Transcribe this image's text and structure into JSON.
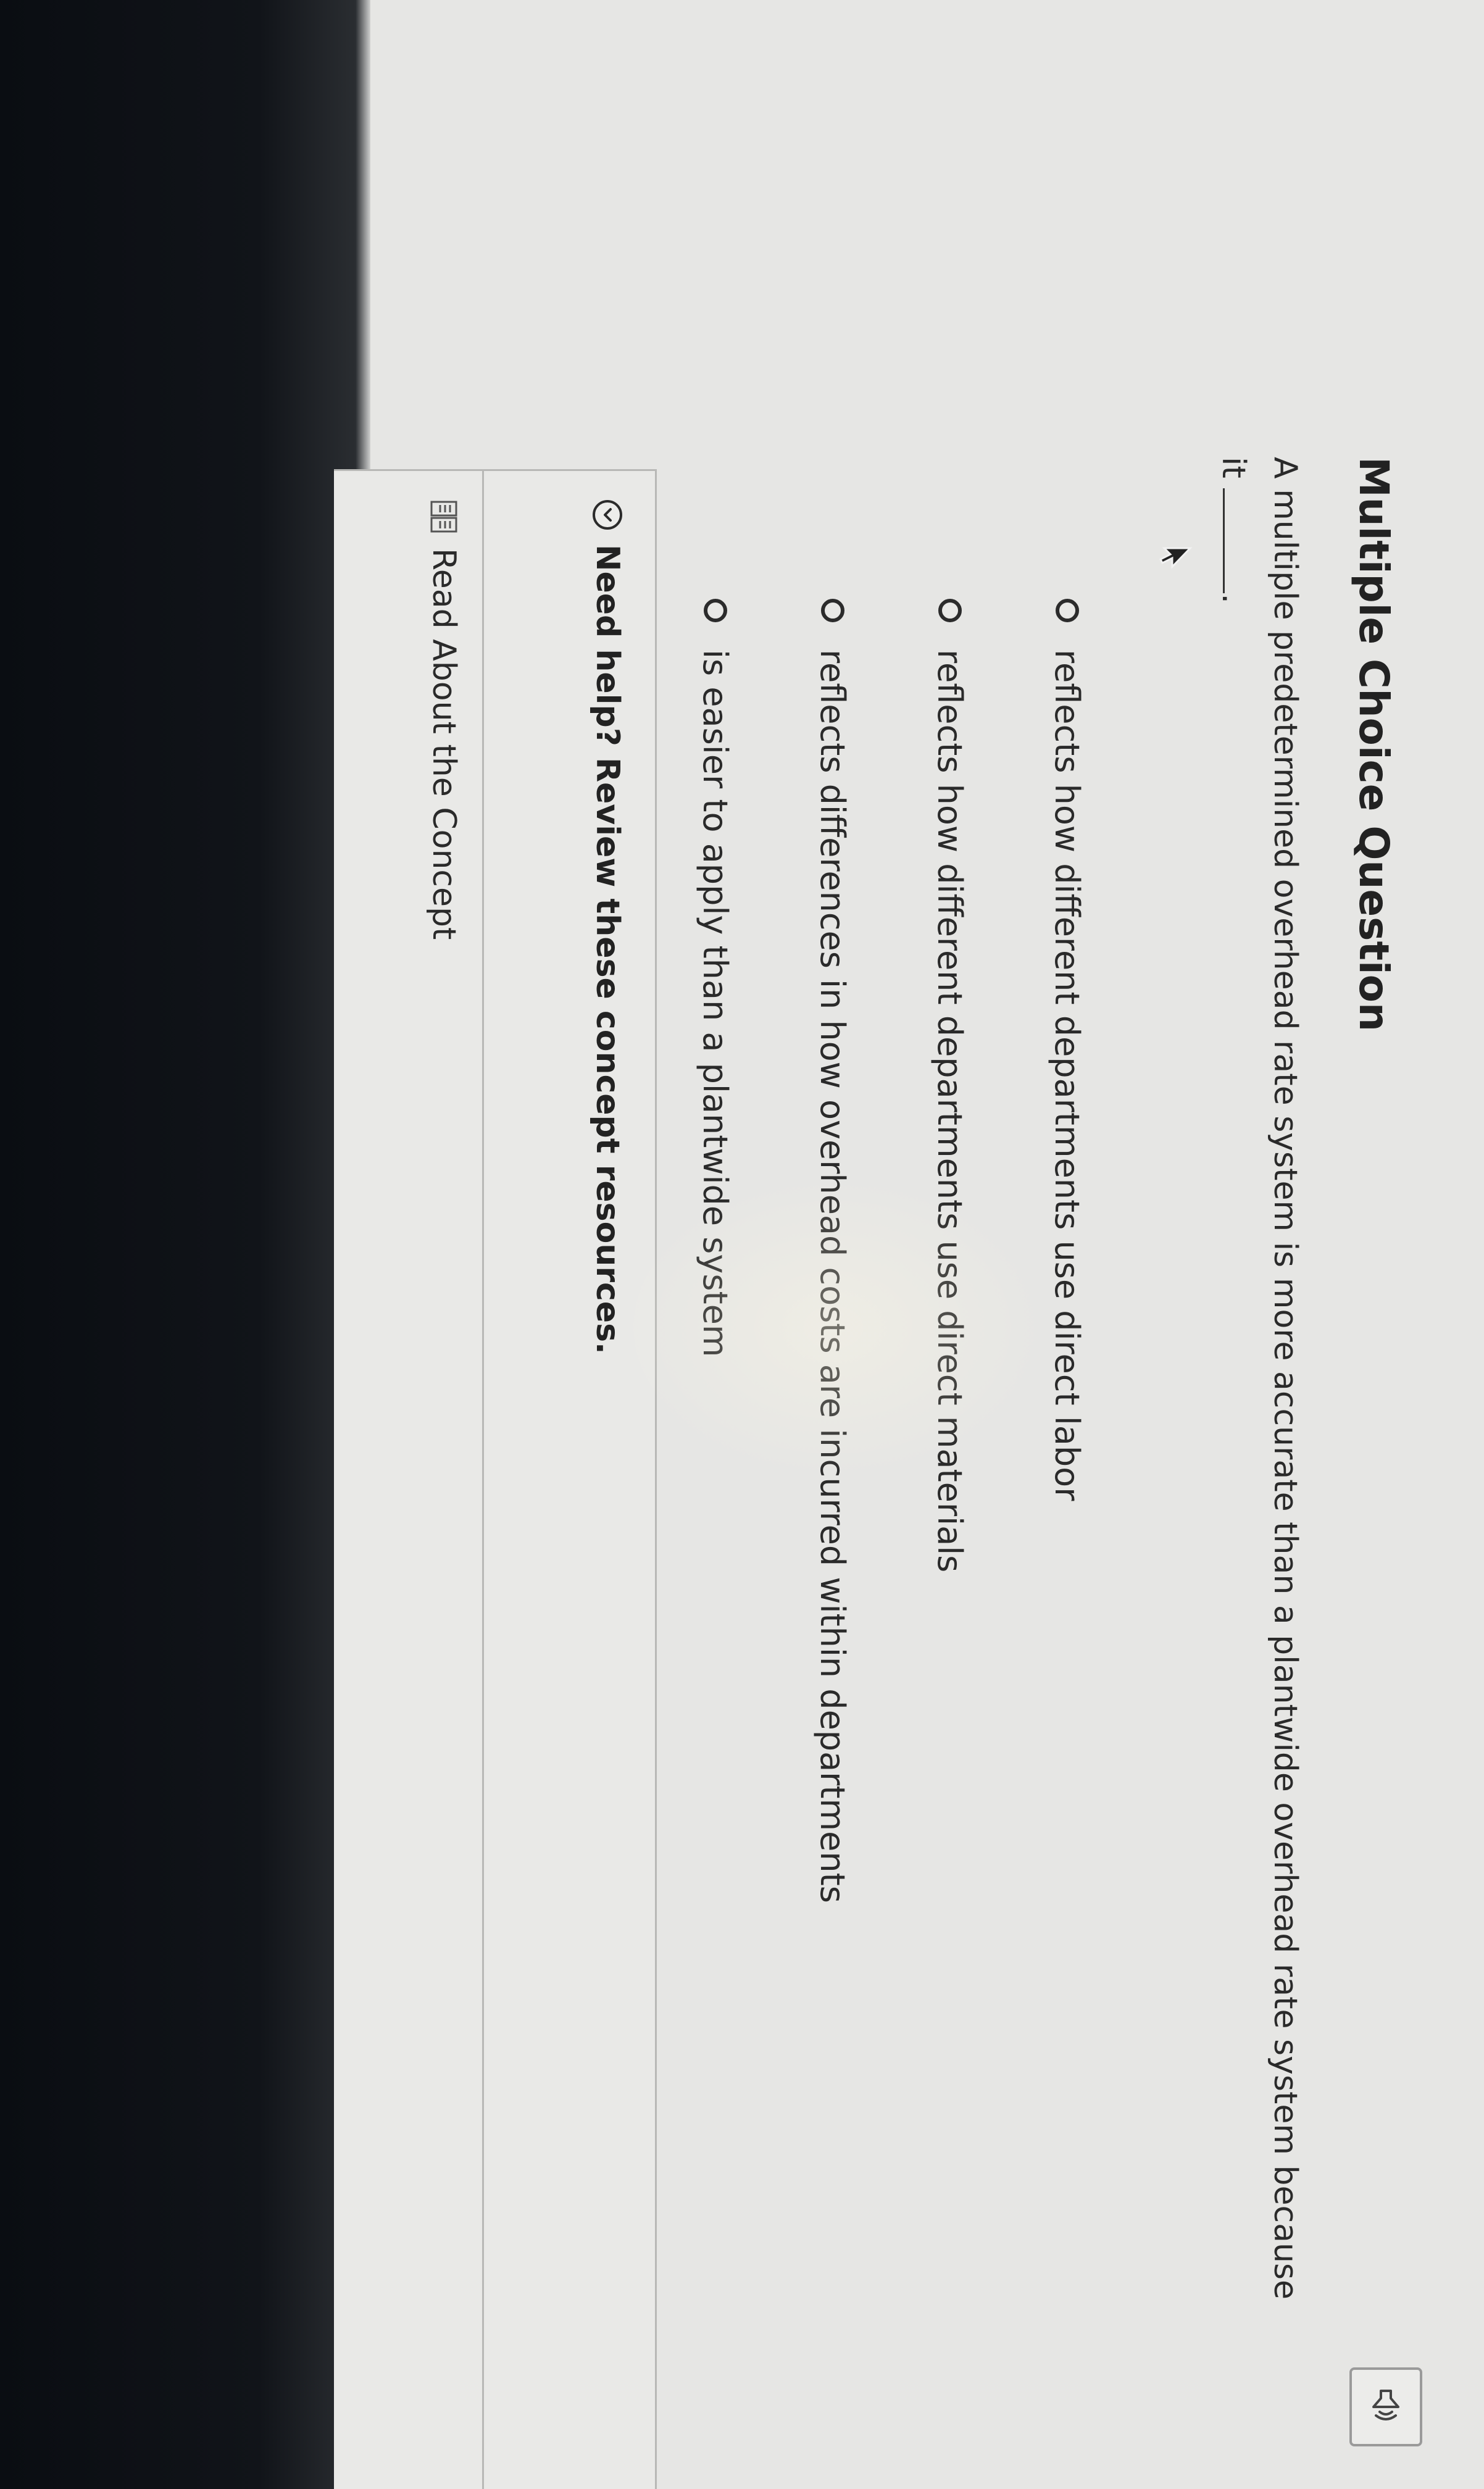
{
  "question_card": {
    "title": "Multiple Choice Question",
    "question_text_before_blank": "A multiple predetermined overhead rate system is more accurate than a plantwide overhead rate system because it",
    "question_text_after_blank": ".",
    "options": [
      {
        "label": "reflects how different departments use direct labor",
        "selected": false
      },
      {
        "label": "reflects how different departments use direct materials",
        "selected": false
      },
      {
        "label": "reflects differences in how overhead costs are incurred within departments",
        "selected": false
      },
      {
        "label": "is easier to apply than a plantwide system",
        "selected": false
      }
    ]
  },
  "help_section": {
    "toggle_text": "Need help? Review these concept resources.",
    "resources": [
      {
        "label": "Read About the Concept",
        "icon": "book-icon"
      }
    ]
  },
  "icons": {
    "audio": "speaker-icon",
    "toggle": "chevron-down-icon"
  }
}
